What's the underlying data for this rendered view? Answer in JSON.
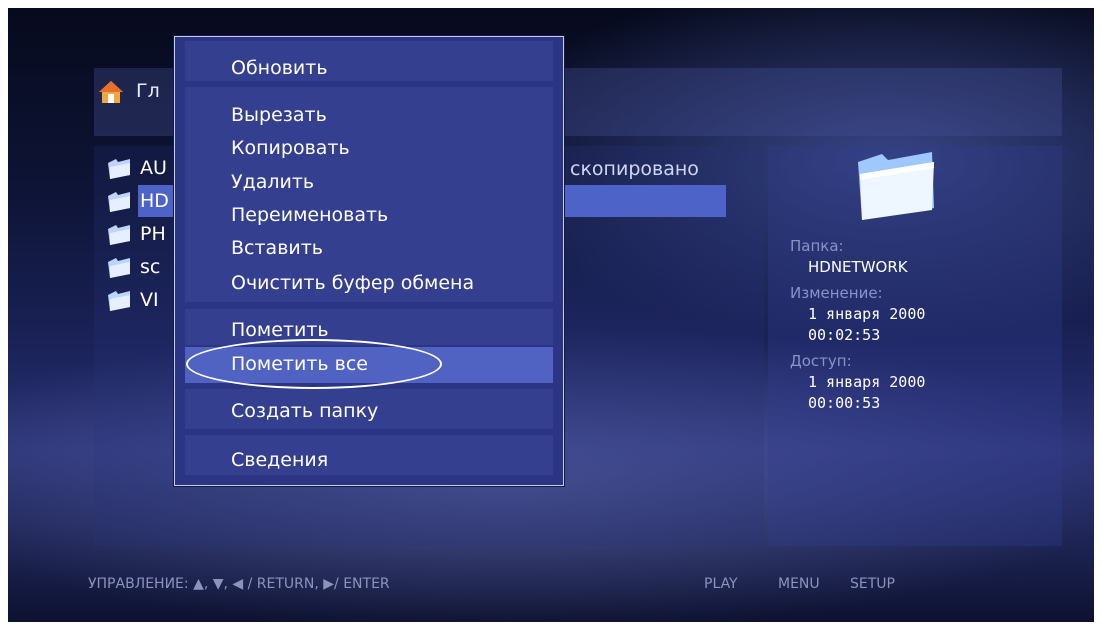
{
  "header": {
    "breadcrumb": "Гл"
  },
  "files": [
    {
      "label": "AU"
    },
    {
      "label": "HD"
    },
    {
      "label": "PH"
    },
    {
      "label": "sc"
    },
    {
      "label": "VI"
    }
  ],
  "status": "скопировано",
  "info": {
    "folder_label": "Папка:",
    "folder_value": "HDNETWORK",
    "modified_label": "Изменение:",
    "modified_date": "1 января 2000",
    "modified_time": "00:02:53",
    "access_label": "Доступ:",
    "access_date": "1 января 2000",
    "access_time": "00:00:53"
  },
  "menu": {
    "items": [
      {
        "label": "Обновить"
      },
      {
        "label": "Вырезать"
      },
      {
        "label": "Копировать"
      },
      {
        "label": "Удалить"
      },
      {
        "label": "Переименовать"
      },
      {
        "label": "Вставить"
      },
      {
        "label": "Очистить буфер обмена"
      },
      {
        "label": "Пометить"
      },
      {
        "label": "Пометить все"
      },
      {
        "label": "Создать папку"
      },
      {
        "label": "Сведения"
      }
    ],
    "selected": "Пометить все"
  },
  "footer": {
    "controls": "УПРАВЛЕНИЕ:  ▲, ▼, ◀ / RETURN, ▶/ ENTER",
    "play": "PLAY",
    "menu": "MENU",
    "setup": "SETUP"
  },
  "colors": {
    "accent": "#4d63c8",
    "menu_bg": "#2b3583",
    "text": "#ffffff",
    "dim_text": "#8a93c8"
  }
}
